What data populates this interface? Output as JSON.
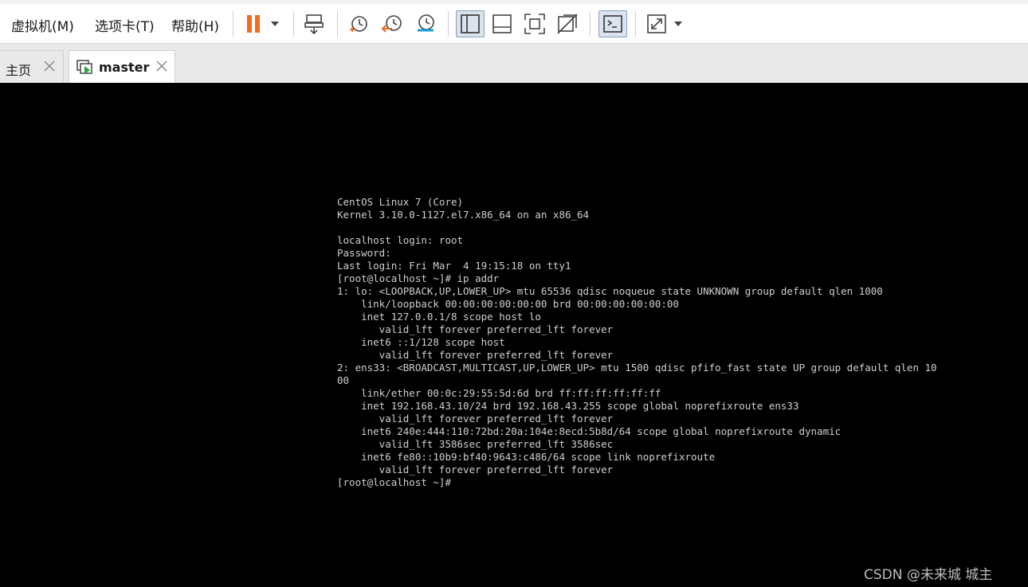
{
  "menu": {
    "vm": "虚拟机(M)",
    "tabs": "选项卡(T)",
    "help": "帮助(H)"
  },
  "toolbar": {
    "icons": [
      "pause-icon",
      "send-keys-icon",
      "snapshot-icon",
      "revert-snapshot-icon",
      "snapshot-manager-icon",
      "library-view-icon",
      "thumbnail-bar-icon",
      "fullscreen-icon",
      "unity-icon",
      "console-view-icon",
      "stretch-icon"
    ],
    "accent_pause": "#f26b21",
    "accent_console_active": "#dbe3ee"
  },
  "tabs": [
    {
      "label": "主页",
      "active": false
    },
    {
      "label": "master",
      "active": true
    }
  ],
  "terminal": {
    "lines": [
      "CentOS Linux 7 (Core)",
      "Kernel 3.10.0-1127.el7.x86_64 on an x86_64",
      "",
      "localhost login: root",
      "Password:",
      "Last login: Fri Mar  4 19:15:18 on tty1",
      "[root@localhost ~]# ip addr",
      "1: lo: <LOOPBACK,UP,LOWER_UP> mtu 65536 qdisc noqueue state UNKNOWN group default qlen 1000",
      "    link/loopback 00:00:00:00:00:00 brd 00:00:00:00:00:00",
      "    inet 127.0.0.1/8 scope host lo",
      "       valid_lft forever preferred_lft forever",
      "    inet6 ::1/128 scope host",
      "       valid_lft forever preferred_lft forever",
      "2: ens33: <BROADCAST,MULTICAST,UP,LOWER_UP> mtu 1500 qdisc pfifo_fast state UP group default qlen 10",
      "00",
      "    link/ether 00:0c:29:55:5d:6d brd ff:ff:ff:ff:ff:ff",
      "    inet 192.168.43.10/24 brd 192.168.43.255 scope global noprefixroute ens33",
      "       valid_lft forever preferred_lft forever",
      "    inet6 240e:444:110:72bd:20a:104e:8ecd:5b8d/64 scope global noprefixroute dynamic",
      "       valid_lft 3586sec preferred_lft 3586sec",
      "    inet6 fe80::10b9:bf40:9643:c486/64 scope link noprefixroute",
      "       valid_lft forever preferred_lft forever",
      "[root@localhost ~]#"
    ]
  },
  "watermark": "CSDN @未来城   城主"
}
